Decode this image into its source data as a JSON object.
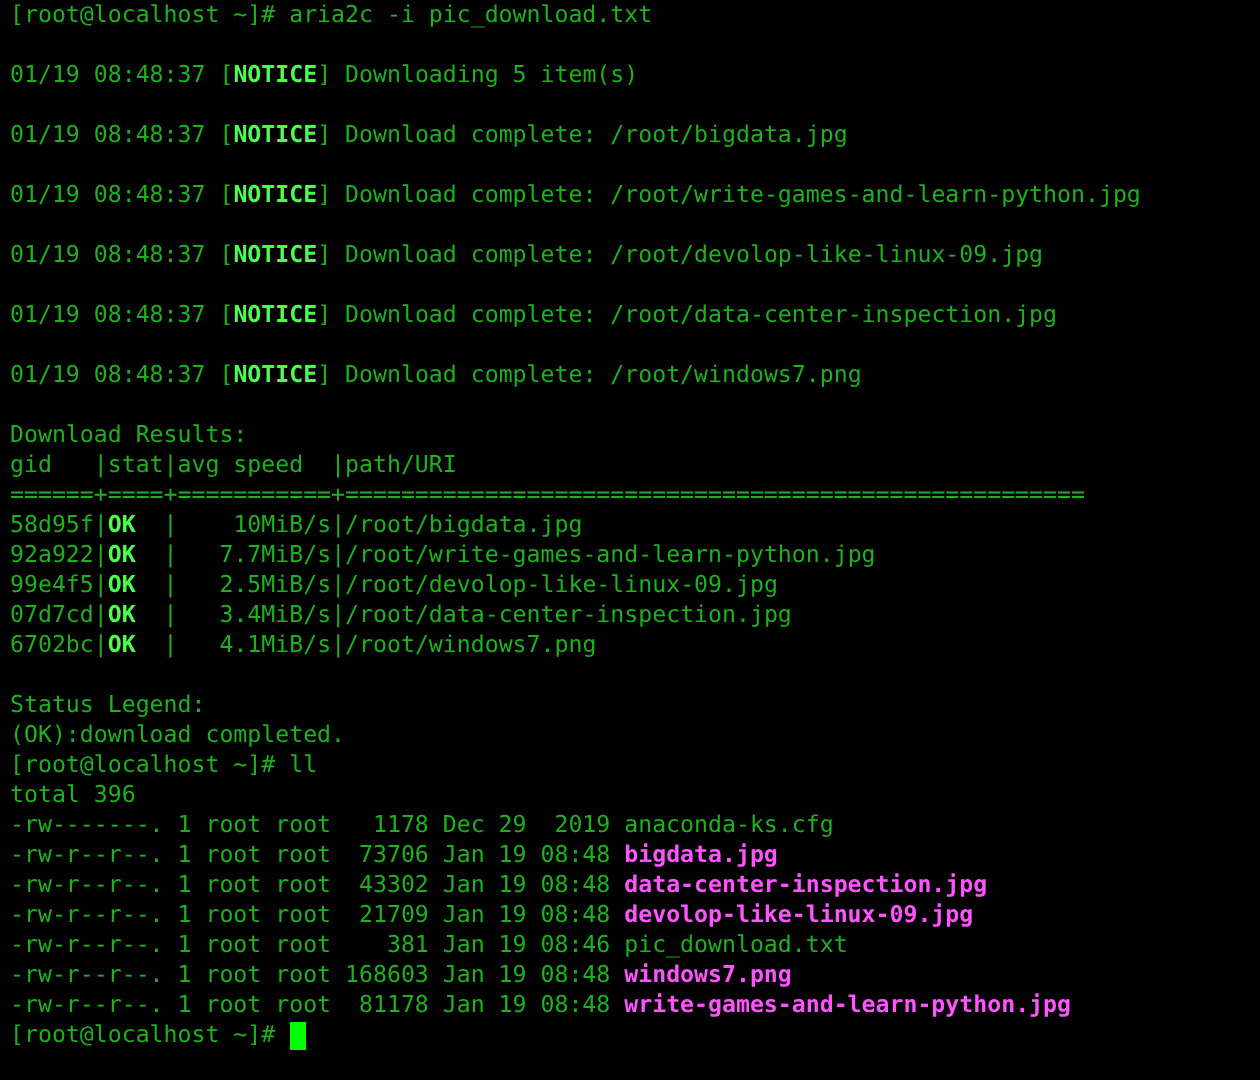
{
  "terminal": {
    "lines": [
      {
        "kind": "text",
        "segments": [
          {
            "text": "[root@localhost ~]# aria2c -i pic_download.txt",
            "kind": "normal"
          }
        ]
      },
      {
        "kind": "blank"
      },
      {
        "kind": "text",
        "segments": [
          {
            "text": "01/19 08:48:37 [",
            "kind": "normal"
          },
          {
            "text": "NOTICE",
            "kind": "highlight"
          },
          {
            "text": "] Downloading 5 item(s)",
            "kind": "normal"
          }
        ]
      },
      {
        "kind": "blank"
      },
      {
        "kind": "text",
        "segments": [
          {
            "text": "01/19 08:48:37 [",
            "kind": "normal"
          },
          {
            "text": "NOTICE",
            "kind": "highlight"
          },
          {
            "text": "] Download complete: /root/bigdata.jpg",
            "kind": "normal"
          }
        ]
      },
      {
        "kind": "blank"
      },
      {
        "kind": "text",
        "segments": [
          {
            "text": "01/19 08:48:37 [",
            "kind": "normal"
          },
          {
            "text": "NOTICE",
            "kind": "highlight"
          },
          {
            "text": "] Download complete: /root/write-games-and-learn-python.jpg",
            "kind": "normal"
          }
        ]
      },
      {
        "kind": "blank"
      },
      {
        "kind": "text",
        "segments": [
          {
            "text": "01/19 08:48:37 [",
            "kind": "normal"
          },
          {
            "text": "NOTICE",
            "kind": "highlight"
          },
          {
            "text": "] Download complete: /root/devolop-like-linux-09.jpg",
            "kind": "normal"
          }
        ]
      },
      {
        "kind": "blank"
      },
      {
        "kind": "text",
        "segments": [
          {
            "text": "01/19 08:48:37 [",
            "kind": "normal"
          },
          {
            "text": "NOTICE",
            "kind": "highlight"
          },
          {
            "text": "] Download complete: /root/data-center-inspection.jpg",
            "kind": "normal"
          }
        ]
      },
      {
        "kind": "blank"
      },
      {
        "kind": "text",
        "segments": [
          {
            "text": "01/19 08:48:37 [",
            "kind": "normal"
          },
          {
            "text": "NOTICE",
            "kind": "highlight"
          },
          {
            "text": "] Download complete: /root/windows7.png",
            "kind": "normal"
          }
        ]
      },
      {
        "kind": "blank"
      },
      {
        "kind": "text",
        "segments": [
          {
            "text": "Download Results:",
            "kind": "normal"
          }
        ]
      },
      {
        "kind": "text",
        "segments": [
          {
            "text": "gid   |stat|avg speed  |path/URI",
            "kind": "normal"
          }
        ]
      },
      {
        "kind": "text",
        "segments": [
          {
            "text": "======+====+===========+=====================================================",
            "kind": "normal"
          }
        ]
      },
      {
        "kind": "text",
        "segments": [
          {
            "text": "58d95f|",
            "kind": "normal"
          },
          {
            "text": "OK",
            "kind": "highlight"
          },
          {
            "text": "  |    10MiB/s|/root/bigdata.jpg",
            "kind": "normal"
          }
        ]
      },
      {
        "kind": "text",
        "segments": [
          {
            "text": "92a922|",
            "kind": "normal"
          },
          {
            "text": "OK",
            "kind": "highlight"
          },
          {
            "text": "  |   7.7MiB/s|/root/write-games-and-learn-python.jpg",
            "kind": "normal"
          }
        ]
      },
      {
        "kind": "text",
        "segments": [
          {
            "text": "99e4f5|",
            "kind": "normal"
          },
          {
            "text": "OK",
            "kind": "highlight"
          },
          {
            "text": "  |   2.5MiB/s|/root/devolop-like-linux-09.jpg",
            "kind": "normal"
          }
        ]
      },
      {
        "kind": "text",
        "segments": [
          {
            "text": "07d7cd|",
            "kind": "normal"
          },
          {
            "text": "OK",
            "kind": "highlight"
          },
          {
            "text": "  |   3.4MiB/s|/root/data-center-inspection.jpg",
            "kind": "normal"
          }
        ]
      },
      {
        "kind": "text",
        "segments": [
          {
            "text": "6702bc|",
            "kind": "normal"
          },
          {
            "text": "OK",
            "kind": "highlight"
          },
          {
            "text": "  |   4.1MiB/s|/root/windows7.png",
            "kind": "normal"
          }
        ]
      },
      {
        "kind": "blank"
      },
      {
        "kind": "text",
        "segments": [
          {
            "text": "Status Legend:",
            "kind": "normal"
          }
        ]
      },
      {
        "kind": "text",
        "segments": [
          {
            "text": "(OK):download completed.",
            "kind": "normal"
          }
        ]
      },
      {
        "kind": "text",
        "segments": [
          {
            "text": "[root@localhost ~]# ll",
            "kind": "normal"
          }
        ]
      },
      {
        "kind": "text",
        "segments": [
          {
            "text": "total 396",
            "kind": "normal"
          }
        ]
      },
      {
        "kind": "text",
        "segments": [
          {
            "text": "-rw-------. 1 root root   1178 Dec 29  2019 anaconda-ks.cfg",
            "kind": "normal"
          }
        ]
      },
      {
        "kind": "text",
        "segments": [
          {
            "text": "-rw-r--r--. 1 root root  73706 Jan 19 08:48 ",
            "kind": "normal"
          },
          {
            "text": "bigdata.jpg",
            "kind": "file"
          }
        ]
      },
      {
        "kind": "text",
        "segments": [
          {
            "text": "-rw-r--r--. 1 root root  43302 Jan 19 08:48 ",
            "kind": "normal"
          },
          {
            "text": "data-center-inspection.jpg",
            "kind": "file"
          }
        ]
      },
      {
        "kind": "text",
        "segments": [
          {
            "text": "-rw-r--r--. 1 root root  21709 Jan 19 08:48 ",
            "kind": "normal"
          },
          {
            "text": "devolop-like-linux-09.jpg",
            "kind": "file"
          }
        ]
      },
      {
        "kind": "text",
        "segments": [
          {
            "text": "-rw-r--r--. 1 root root    381 Jan 19 08:46 pic_download.txt",
            "kind": "normal"
          }
        ]
      },
      {
        "kind": "text",
        "segments": [
          {
            "text": "-rw-r--r--. 1 root root 168603 Jan 19 08:48 ",
            "kind": "normal"
          },
          {
            "text": "windows7.png",
            "kind": "file"
          }
        ]
      },
      {
        "kind": "text",
        "segments": [
          {
            "text": "-rw-r--r--. 1 root root  81178 Jan 19 08:48 ",
            "kind": "normal"
          },
          {
            "text": "write-games-and-learn-python.jpg",
            "kind": "file"
          }
        ]
      },
      {
        "kind": "text",
        "cursor": true,
        "segments": [
          {
            "text": "[root@localhost ~]# ",
            "kind": "normal"
          }
        ]
      }
    ]
  }
}
